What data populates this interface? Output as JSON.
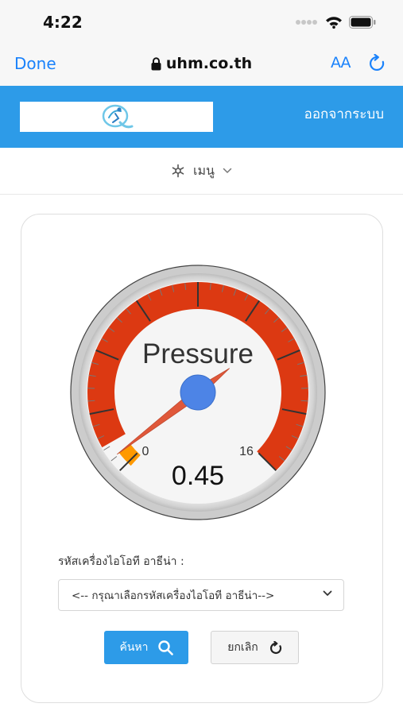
{
  "status_bar": {
    "time": "4:22",
    "icons": [
      "signal-dots-icon",
      "wifi-icon",
      "battery-icon"
    ]
  },
  "browser": {
    "done_label": "Done",
    "url": "uhm.co.th",
    "text_size_label": "AA",
    "icons": [
      "lock-icon",
      "text-size-icon",
      "reload-icon"
    ]
  },
  "header": {
    "logout_label": "ออกจากระบบ",
    "background": "#2d9be8",
    "logo_icon": "q-logo-icon"
  },
  "menu": {
    "label": "เมนู",
    "icons": [
      "menu-gear-icon",
      "chevron-down-icon"
    ]
  },
  "gauge": {
    "title": "Pressure",
    "value": 0.45,
    "value_label": "0.45",
    "min": 0,
    "max": 16,
    "min_label": "0",
    "max_label": "16",
    "red_zone_color": "#dc3912",
    "needle_color": "#e0583a",
    "hub_color": "#4d84e6",
    "yellow_color": "#ff9900"
  },
  "form": {
    "field_label": "รหัสเครื่องไอโอที อาธีน่า :",
    "select_value": "<-- กรุณาเลือกรหัสเครื่องไอโอที อาธีน่า-->",
    "search_label": "ค้นหา",
    "cancel_label": "ยกเลิก",
    "accent": "#2d9be8",
    "icons": [
      "search-icon",
      "refresh-icon",
      "chevron-down-icon"
    ]
  }
}
